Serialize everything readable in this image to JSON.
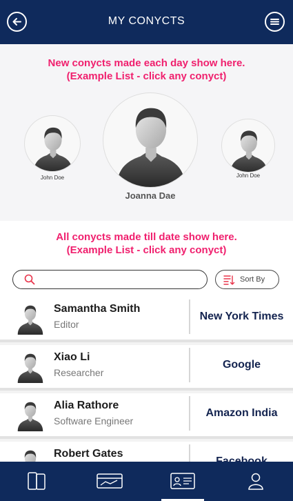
{
  "header": {
    "title": "MY CONYCTS",
    "back_icon": "arrow-left-icon",
    "menu_icon": "hamburger-menu-icon"
  },
  "featured": {
    "heading_line1": "New conycts made each day show here.",
    "heading_line2": "(Example List - click any conyct)",
    "people": [
      {
        "name": "John Doe"
      },
      {
        "name": "Joanna Dae"
      },
      {
        "name": "John Doe"
      }
    ]
  },
  "all": {
    "heading_line1": "All conycts made till date show here.",
    "heading_line2": "(Example List - click any conyct)",
    "search_placeholder": "",
    "sort_label": "Sort By"
  },
  "contacts": [
    {
      "name": "Samantha Smith",
      "role": "Editor",
      "company": "New York Times"
    },
    {
      "name": "Xiao Li",
      "role": "Researcher",
      "company": "Google"
    },
    {
      "name": "Alia Rathore",
      "role": "Software Engineer",
      "company": "Amazon India"
    },
    {
      "name": "Robert Gates",
      "role": "",
      "company": "Facebook"
    }
  ],
  "tabbar": {
    "tabs": [
      {
        "icon": "phones-icon"
      },
      {
        "icon": "card-icon"
      },
      {
        "icon": "contact-cards-icon",
        "active": true
      },
      {
        "icon": "user-profile-icon"
      }
    ]
  },
  "colors": {
    "navy": "#0f2a5c",
    "accent_pink": "#f0206e",
    "company_text": "#13234f"
  }
}
